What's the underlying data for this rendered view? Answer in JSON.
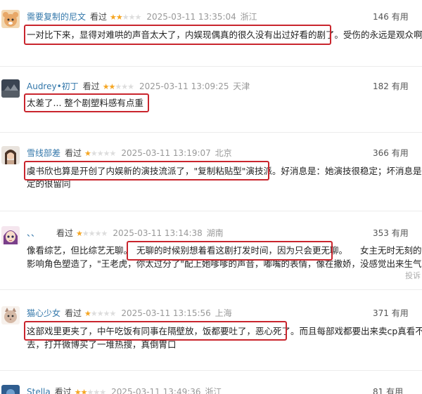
{
  "reviews": [
    {
      "user": "需要复制的尼文",
      "watched": "看过",
      "stars": 2,
      "time": "2025-03-11 13:35:04",
      "location": "浙江",
      "useful_count": "146",
      "useful_label": "有用",
      "line1": "一对比下来，显得对难哄的声音太大了，内娱现偶真的很久没有出过好看的剧了。受伤的永远是观众啊。"
    },
    {
      "user": "Audrey•初丁",
      "watched": "看过",
      "stars": 2,
      "time": "2025-03-11 13:09:25",
      "location": "天津",
      "useful_count": "182",
      "useful_label": "有用",
      "line1": "太差了... 整个剧塑料感有点重"
    },
    {
      "user": "雪线部差",
      "watched": "看过",
      "stars": 1,
      "time": "2025-03-11 13:19:07",
      "location": "北京",
      "useful_count": "366",
      "useful_label": "有用",
      "line1": "虞书欣也算是开创了内娱新的演技流派了，\"复制粘贴型\"演技派。好消息是：她演技很稳定；坏消息是：稳",
      "line2": "定的很留同"
    },
    {
      "user": "、、",
      "watched": "看过",
      "stars": 1,
      "time": "2025-03-11 13:14:38",
      "location": "湖南",
      "useful_count": "353",
      "useful_label": "有用",
      "line0": "像看综艺，但比综艺无聊。",
      "line0b": "无聊的时候别想着看这剧打发时间，因为只会更无聊。",
      "line0c": "女主无时无刻的夹子音都",
      "line2": "影响角色塑造了，\"王老虎，你太过分了\"配上她嗲嗲的声音，嘟嘴的表情，像在撒娇，没感觉出来生气。",
      "report": "投诉"
    },
    {
      "user": "猫心少女",
      "watched": "看过",
      "stars": 1,
      "time": "2025-03-11 13:15:56",
      "location": "上海",
      "useful_count": "371",
      "useful_label": "有用",
      "line1": "这部戏里更夹了，中午吃饭有同事在隔壁放，饭都要吐了，恶心死了。而且每部戏都要出来卖cp真看不下",
      "line2": "去，打开微博买了一堆热搜，真倒胃口"
    },
    {
      "user": "Stella",
      "watched": "看过",
      "stars": 2,
      "time": "2025-03-11 13:49:36",
      "location": "浙江",
      "useful_count": "81",
      "useful_label": "有用"
    }
  ]
}
